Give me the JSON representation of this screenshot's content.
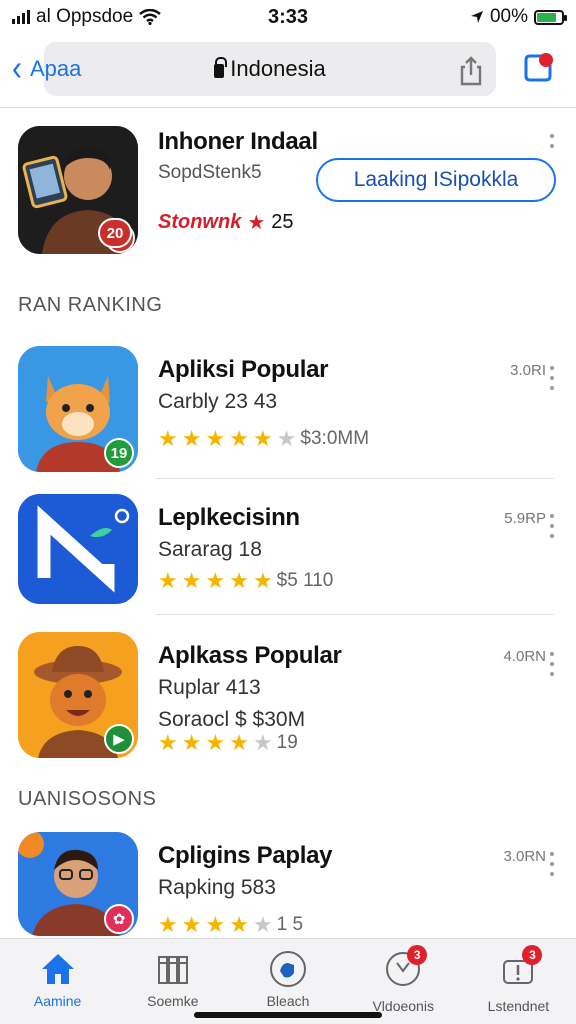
{
  "status": {
    "carrier": "al Oppsdoe",
    "time": "3:33",
    "battery": "00%"
  },
  "nav": {
    "back_label": "Apaa",
    "search_title": "Indonesia"
  },
  "featured": {
    "title": "Inhoner Indaal",
    "subtitle": "SopdStenk5",
    "rating_word": "Stonwnk",
    "rating_count": "25",
    "action_label": "Laaking ISipokkla",
    "icon_badge": "20",
    "icon_colors": {
      "bg": "#1d1d1d",
      "accent": "#c9302c"
    }
  },
  "sections": {
    "ranking": "RAN RANKING",
    "second": "UANISOSONS"
  },
  "apps": [
    {
      "title": "Apliksi Popular",
      "line1": "Carbly 23 43",
      "line2": "",
      "rating": 4.5,
      "stars_text": "$3:0MM",
      "meta": "3.0RI",
      "badge": "19",
      "colors": {
        "bg": "#2f8fe0",
        "fg": "#f3a040",
        "badge": "#1f9d3a"
      }
    },
    {
      "title": "Leplkecisinn",
      "line1": "Sararag 18",
      "line2": "",
      "rating": 5,
      "stars_text": "$5 110",
      "meta": "5.9RP",
      "badge": "",
      "colors": {
        "bg": "#1d5ad6",
        "fg": "#ffffff",
        "badge": ""
      }
    },
    {
      "title": "Aplkass Popular",
      "line1": "Ruplar 413",
      "line2": "Soraocl $ $30M",
      "rating": 4,
      "stars_text": "19",
      "meta": "4.0RN",
      "badge": "▶",
      "colors": {
        "bg": "#f29a1f",
        "fg": "#a5582c",
        "badge": "#1f8f3a"
      }
    },
    {
      "title": "Cpligins Paplay",
      "line1": "Rapking 583",
      "line2": "",
      "rating": 4,
      "stars_text": "1 5",
      "meta": "3.0RN",
      "badge": "✿",
      "colors": {
        "bg": "#2d7be0",
        "fg": "#8a3a2a",
        "badge": "#e0305a"
      }
    }
  ],
  "tabs": [
    {
      "label": "Aamine",
      "icon": "house-icon",
      "active": true,
      "badge": ""
    },
    {
      "label": "Soemke",
      "icon": "books-icon",
      "active": false,
      "badge": ""
    },
    {
      "label": "Bleach",
      "icon": "hand-icon",
      "active": false,
      "badge": ""
    },
    {
      "label": "Vldoeonis",
      "icon": "clock-icon",
      "active": false,
      "badge": "3"
    },
    {
      "label": "Lstendnet",
      "icon": "tray-icon",
      "active": false,
      "badge": "3"
    }
  ]
}
